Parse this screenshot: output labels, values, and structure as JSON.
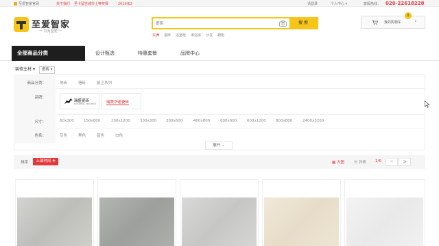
{
  "topbar": {
    "site": "至爱智家官网",
    "notice_a": "关于我们",
    "notice_b": "圣卡留吉城市上等奖赛",
    "notice_date": "2019年2",
    "login": "请登录",
    "account": "个人中心",
    "hotline_label": "客服热线：",
    "hotline": "020-22618228"
  },
  "header": {
    "logo_text": "至爱智家",
    "slogan": "一 只为至爱 一",
    "search_placeholder": "瓷砖",
    "search_button": "搜 索",
    "hot_words": [
      "买满",
      "瓷砖",
      "浴室柜",
      "淋浴房",
      "沙发",
      "橱柜"
    ],
    "cart_label": "我的购物车",
    "cart_count": "0"
  },
  "nav": {
    "all_categories": "全部商品分类",
    "items": [
      "设计甄选",
      "特惠套餐",
      "品牌中心"
    ]
  },
  "crumbs": {
    "category": "装修主材",
    "sub": "瓷砖"
  },
  "filters": {
    "category_label": "商品分类：",
    "categories": [
      "地砖",
      "墙砖",
      "厨卫系列"
    ],
    "brand_label": "品牌：",
    "brand_1": "瑞盛瓷砖",
    "brand_1_sub": "RUISHENG CERAMICS",
    "brand_2": "瑞美华诺瓷砖",
    "size_label": "尺寸：",
    "sizes": [
      "60x300",
      "150x800",
      "200x1200",
      "300x300",
      "300x600",
      "400x800",
      "600x600",
      "600x1200",
      "800x800",
      "2400x3200"
    ],
    "color_label": "色系：",
    "colors": [
      "灰色",
      "黑色",
      "蓝色",
      "白色"
    ],
    "expand": "展开"
  },
  "sortbar": {
    "label": "排序：",
    "active_sort": "上架时间",
    "view_big": "大图",
    "view_list": "列表",
    "page": "1/6",
    "prev": "<",
    "next": ">"
  },
  "products": [
    {
      "swatch_color": "#c9c9c6"
    },
    {
      "swatch_color": "#a9aba8"
    },
    {
      "swatch_color": "#d0d0cf"
    },
    {
      "swatch_color": "#ece3d2"
    },
    {
      "swatch_color": "#efefef"
    }
  ],
  "colors": {
    "accent_yellow": "#f5c518",
    "accent_red": "#e4393c",
    "nav_dark": "#1e1e1e"
  }
}
